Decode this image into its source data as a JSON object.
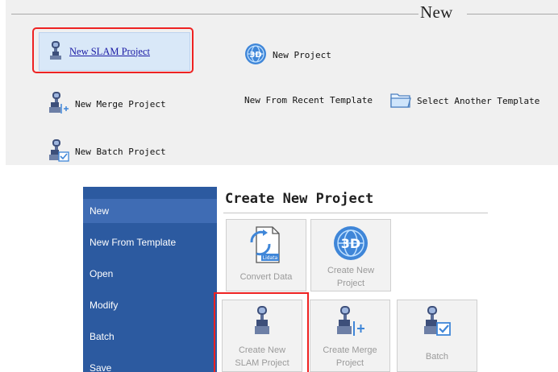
{
  "top_panel": {
    "header": "New",
    "options": {
      "new_slam_project": "New SLAM Project",
      "new_project": "New Project",
      "new_merge_project": "New Merge Project",
      "new_from_recent_template": "New From Recent Template",
      "select_another_template": "Select Another Template",
      "new_batch_project": "New Batch Project"
    }
  },
  "backstage": {
    "sidebar": [
      "New",
      "New From Template",
      "Open",
      "Modify",
      "Batch",
      "Save"
    ],
    "title": "Create New Project",
    "tiles": {
      "convert_data": "Convert Data",
      "create_new_project_1": "Create New",
      "create_new_project_2": "Project",
      "create_slam_project_1": "Create New",
      "create_slam_project_2": "SLAM Project",
      "create_merge_project_1": "Create Merge",
      "create_merge_project_2": "Project",
      "batch": "Batch"
    },
    "icon_labels": {
      "lidata": "Lidata",
      "three_d": "3D"
    }
  },
  "colors": {
    "sidebar_bg": "#2c5aa0",
    "highlight_red": "#ee2222",
    "selected_bg": "#d9e8f8",
    "link_blue": "#1a1aa5"
  },
  "icons": [
    "slam-device-icon",
    "globe-3d-icon",
    "merge-device-icon",
    "folder-icon",
    "batch-device-icon",
    "convert-data-icon"
  ]
}
